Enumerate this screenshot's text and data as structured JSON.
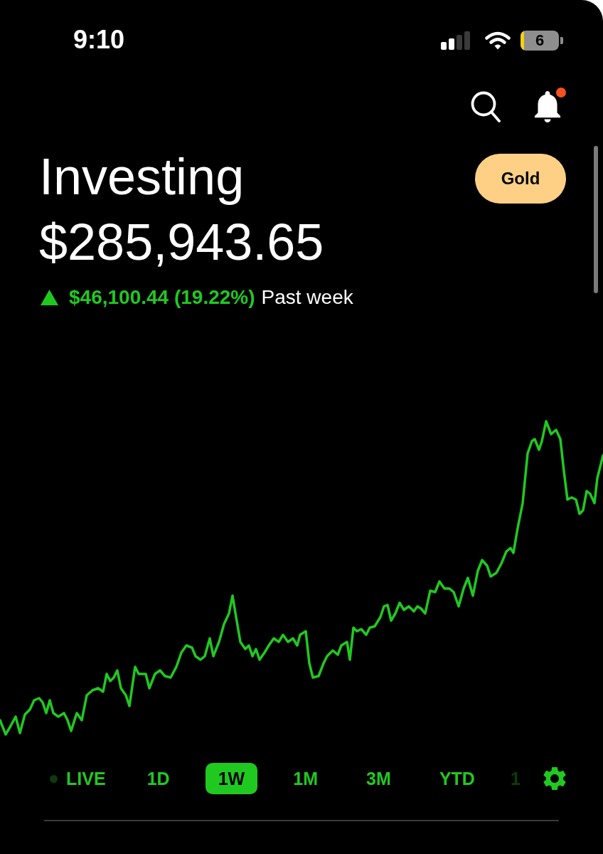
{
  "status_bar": {
    "time": "9:10",
    "battery": "6"
  },
  "header": {
    "notifications_unread": true
  },
  "title": "Investing",
  "upgrade_button": {
    "label": "Gold"
  },
  "balance": "$285,943.65",
  "change": {
    "up": true,
    "amount": "$46,100.44 (19.22%)",
    "period": "Past week"
  },
  "ranges": [
    {
      "label": "LIVE",
      "kind": "live",
      "selected": false
    },
    {
      "label": "1D",
      "kind": "range",
      "selected": false
    },
    {
      "label": "1W",
      "kind": "range",
      "selected": true
    },
    {
      "label": "1M",
      "kind": "range",
      "selected": false
    },
    {
      "label": "3M",
      "kind": "range",
      "selected": false
    },
    {
      "label": "YTD",
      "kind": "range",
      "selected": false
    },
    {
      "label": "1",
      "kind": "cut_off",
      "selected": false
    }
  ]
}
